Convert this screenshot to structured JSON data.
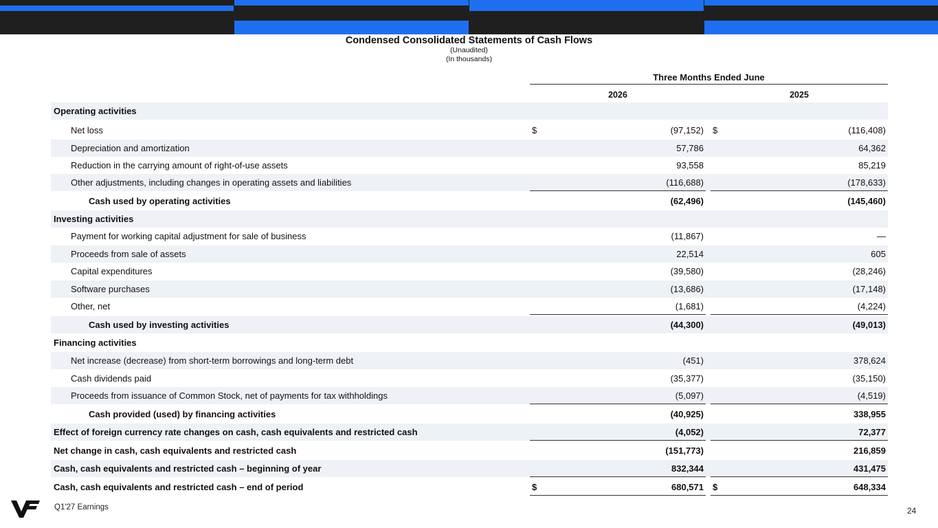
{
  "banner": {
    "colors": {
      "dark": "#1f1f1f",
      "accent": "#1e6ff0"
    }
  },
  "header": {
    "title": "Condensed Consolidated Statements of Cash Flows",
    "subtitle1": "(Unaudited)",
    "subtitle2": "(In thousands)"
  },
  "table": {
    "period_header": "Three Months Ended June",
    "col1_year": "2026",
    "col2_year": "2025",
    "rows": [
      {
        "label": "Operating activities"
      },
      {
        "label": "Net loss",
        "cur1": "$",
        "v1": "(97,152)",
        "cur2": "$",
        "v2": "(116,408)"
      },
      {
        "label": "Depreciation and amortization",
        "v1": "57,786",
        "v2": "64,362"
      },
      {
        "label": "Reduction in the carrying amount of right-of-use assets",
        "v1": "93,558",
        "v2": "85,219"
      },
      {
        "label": "Other adjustments, including changes in operating assets and liabilities",
        "v1": "(116,688)",
        "v2": "(178,633)"
      },
      {
        "label": "Cash used by operating activities",
        "v1": "(62,496)",
        "v2": "(145,460)"
      },
      {
        "label": "Investing activities"
      },
      {
        "label": "Payment for working capital adjustment for sale of business",
        "v1": "(11,867)",
        "v2": "—"
      },
      {
        "label": "Proceeds from sale of assets",
        "v1": "22,514",
        "v2": "605"
      },
      {
        "label": "Capital expenditures",
        "v1": "(39,580)",
        "v2": "(28,246)"
      },
      {
        "label": "Software purchases",
        "v1": "(13,686)",
        "v2": "(17,148)"
      },
      {
        "label": "Other, net",
        "v1": "(1,681)",
        "v2": "(4,224)"
      },
      {
        "label": "Cash used by investing activities",
        "v1": "(44,300)",
        "v2": "(49,013)"
      },
      {
        "label": "Financing activities"
      },
      {
        "label": "Net increase (decrease) from short-term borrowings and long-term debt",
        "v1": "(451)",
        "v2": "378,624"
      },
      {
        "label": "Cash dividends paid",
        "v1": "(35,377)",
        "v2": "(35,150)"
      },
      {
        "label": "Proceeds from issuance of Common Stock, net of payments for tax withholdings",
        "v1": "(5,097)",
        "v2": "(4,519)"
      },
      {
        "label": "Cash provided (used) by financing activities",
        "v1": "(40,925)",
        "v2": "338,955"
      },
      {
        "label": "Effect of foreign currency rate changes on cash, cash equivalents and restricted cash",
        "v1": "(4,052)",
        "v2": "72,377"
      },
      {
        "label": "Net change in cash, cash equivalents and restricted cash",
        "v1": "(151,773)",
        "v2": "216,859"
      },
      {
        "label": "Cash, cash equivalents and restricted cash – beginning of year",
        "v1": "832,344",
        "v2": "431,475"
      },
      {
        "label": "Cash, cash equivalents and restricted cash – end of period",
        "cur1": "$",
        "v1": "680,571",
        "cur2": "$",
        "v2": "648,334"
      }
    ]
  },
  "footer": {
    "logo_icon": "vf-logo-icon",
    "label": "Q1'27 Earnings",
    "page_number": "24"
  }
}
